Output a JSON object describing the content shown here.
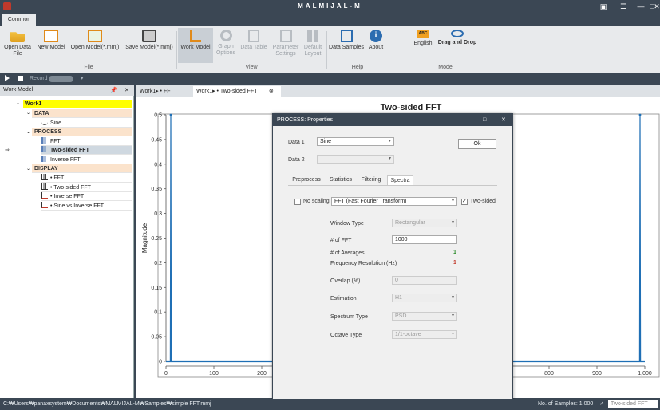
{
  "app": {
    "title": "MALMIJAL-M"
  },
  "window_controls": {
    "restore": "▣",
    "menu": "☰",
    "minimize": "—",
    "maximize": "□",
    "close": "✕"
  },
  "ribbon_tab": "Common",
  "ribbon": {
    "file": {
      "label": "File",
      "items": [
        "Open Data\nFile",
        "New Model",
        "Open Model(*.mmj)",
        "Save Model(*.mmj)"
      ]
    },
    "view": {
      "label": "View",
      "items": [
        "Work Model",
        "Graph\nOptions",
        "Data Table",
        "Parameter\nSettings",
        "Default\nLayout"
      ]
    },
    "help": {
      "label": "Help",
      "items": [
        "Data Samples",
        "About"
      ]
    },
    "mode": {
      "label": "Mode",
      "items": [
        "English",
        "Drag and Drop"
      ]
    }
  },
  "runbar": {
    "record": "Record"
  },
  "work_model": {
    "title": "Work Model",
    "root": "Work1",
    "data_cat": "DATA",
    "data_items": [
      "Sine"
    ],
    "process_cat": "PROCESS",
    "process_items": [
      "FFT",
      "Two-sided FFT",
      "Inverse FFT"
    ],
    "display_cat": "DISPLAY",
    "display_items": [
      "• FFT",
      "• Two-sided FFT",
      "• Inverse FFT",
      "• Sine vs Inverse FFT"
    ]
  },
  "doc_tabs": [
    "Work1▸ • FFT",
    "Work1▸ • Two-sided FFT"
  ],
  "chart_data": {
    "type": "line",
    "title": "Two-sided FFT",
    "ylabel": "Magnitude",
    "xlabel": "",
    "xlim": [
      0,
      1000
    ],
    "ylim": [
      0,
      0.5
    ],
    "x_ticks": [
      "0",
      "100",
      "200",
      "800",
      "900",
      "1,000"
    ],
    "y_ticks": [
      "0",
      "0.05",
      "0.1",
      "0.15",
      "0.2",
      "0.25",
      "0.3",
      "0.35",
      "0.4",
      "0.45",
      "0.5"
    ],
    "series": [
      {
        "x": [
          0,
          9,
          10,
          11,
          989,
          990,
          991,
          999
        ],
        "values": [
          0,
          0,
          0.5,
          0,
          0,
          0.5,
          0,
          0
        ],
        "color": "#1f6fb5"
      }
    ]
  },
  "dialog": {
    "title": "PROCESS: Properties",
    "data1_label": "Data 1",
    "data1_value": "Sine",
    "data2_label": "Data 2",
    "data2_value": "",
    "ok": "Ok",
    "tabs": [
      "Preprocess",
      "Statistics",
      "Filtering",
      "Spectra"
    ],
    "no_scaling": "No scaling",
    "method": "FFT (Fast Fourier Transform)",
    "two_sided": "Two-sided",
    "window_type_label": "Window Type",
    "window_type": "Rectangular",
    "nfft_label": "# of FFT",
    "nfft": "1000",
    "averages_label": "# of Averages",
    "averages": "1",
    "freq_res_label": "Frequency Resolution (Hz)",
    "freq_res": "1",
    "overlap_label": "Overlap (%)",
    "overlap": "0",
    "estimation_label": "Estimation",
    "estimation": "H1",
    "spectrum_type_label": "Spectrum Type",
    "spectrum_type": "PSD",
    "octave_type_label": "Octave Type",
    "octave_type": "1/1-octave"
  },
  "status": {
    "path": "C:₩Users₩panaxsystem₩Documents₩MALMIJAL-M₩Samples₩simple FFT.mmj",
    "samples": "No. of Samples: 1,000",
    "check": "✓",
    "selector": "Two-sided FFT"
  },
  "colors": {
    "accent": "#3b4754",
    "root_highlight": "#ffff00",
    "category_bg": "#fbe3cc"
  }
}
